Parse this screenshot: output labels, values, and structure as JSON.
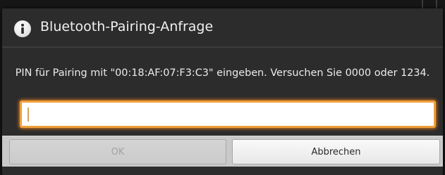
{
  "dialog": {
    "title": "Bluetooth-Pairing-Anfrage",
    "icon": "info-icon",
    "message": "PIN für Pairing mit \"00:18:AF:07:F3:C3\" eingeben. Versuchen Sie 0000 oder 1234.",
    "pin_value": "",
    "ok_label": "OK",
    "cancel_label": "Abbrechen"
  },
  "colors": {
    "dialog_bg": "#2c2c2c",
    "input_focus": "#f0a03c",
    "button_bar": "#c9c9c9"
  }
}
